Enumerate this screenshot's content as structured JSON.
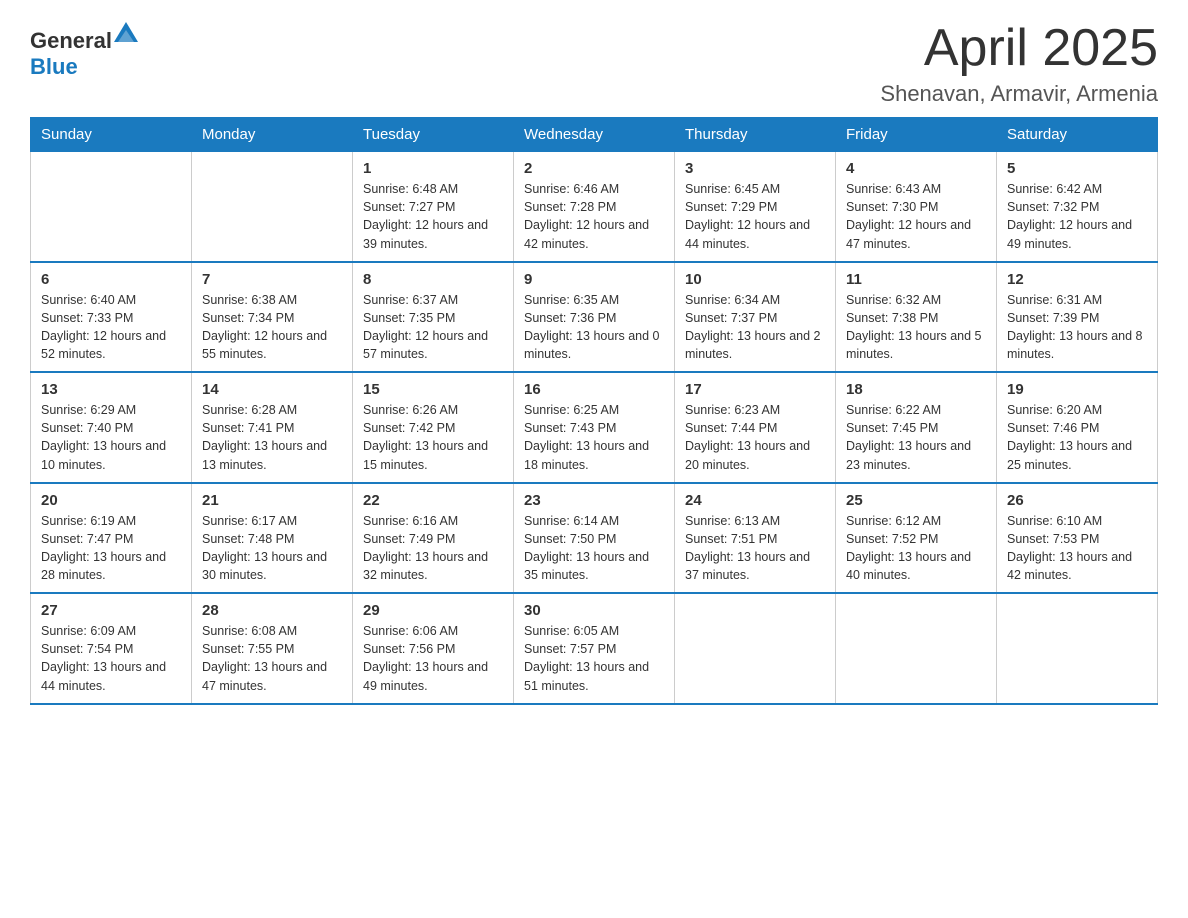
{
  "header": {
    "logo": {
      "text_general": "General",
      "text_blue": "Blue"
    },
    "title": "April 2025",
    "location": "Shenavan, Armavir, Armenia"
  },
  "days_of_week": [
    "Sunday",
    "Monday",
    "Tuesday",
    "Wednesday",
    "Thursday",
    "Friday",
    "Saturday"
  ],
  "weeks": [
    [
      {
        "day": "",
        "sunrise": "",
        "sunset": "",
        "daylight": ""
      },
      {
        "day": "",
        "sunrise": "",
        "sunset": "",
        "daylight": ""
      },
      {
        "day": "1",
        "sunrise": "Sunrise: 6:48 AM",
        "sunset": "Sunset: 7:27 PM",
        "daylight": "Daylight: 12 hours and 39 minutes."
      },
      {
        "day": "2",
        "sunrise": "Sunrise: 6:46 AM",
        "sunset": "Sunset: 7:28 PM",
        "daylight": "Daylight: 12 hours and 42 minutes."
      },
      {
        "day": "3",
        "sunrise": "Sunrise: 6:45 AM",
        "sunset": "Sunset: 7:29 PM",
        "daylight": "Daylight: 12 hours and 44 minutes."
      },
      {
        "day": "4",
        "sunrise": "Sunrise: 6:43 AM",
        "sunset": "Sunset: 7:30 PM",
        "daylight": "Daylight: 12 hours and 47 minutes."
      },
      {
        "day": "5",
        "sunrise": "Sunrise: 6:42 AM",
        "sunset": "Sunset: 7:32 PM",
        "daylight": "Daylight: 12 hours and 49 minutes."
      }
    ],
    [
      {
        "day": "6",
        "sunrise": "Sunrise: 6:40 AM",
        "sunset": "Sunset: 7:33 PM",
        "daylight": "Daylight: 12 hours and 52 minutes."
      },
      {
        "day": "7",
        "sunrise": "Sunrise: 6:38 AM",
        "sunset": "Sunset: 7:34 PM",
        "daylight": "Daylight: 12 hours and 55 minutes."
      },
      {
        "day": "8",
        "sunrise": "Sunrise: 6:37 AM",
        "sunset": "Sunset: 7:35 PM",
        "daylight": "Daylight: 12 hours and 57 minutes."
      },
      {
        "day": "9",
        "sunrise": "Sunrise: 6:35 AM",
        "sunset": "Sunset: 7:36 PM",
        "daylight": "Daylight: 13 hours and 0 minutes."
      },
      {
        "day": "10",
        "sunrise": "Sunrise: 6:34 AM",
        "sunset": "Sunset: 7:37 PM",
        "daylight": "Daylight: 13 hours and 2 minutes."
      },
      {
        "day": "11",
        "sunrise": "Sunrise: 6:32 AM",
        "sunset": "Sunset: 7:38 PM",
        "daylight": "Daylight: 13 hours and 5 minutes."
      },
      {
        "day": "12",
        "sunrise": "Sunrise: 6:31 AM",
        "sunset": "Sunset: 7:39 PM",
        "daylight": "Daylight: 13 hours and 8 minutes."
      }
    ],
    [
      {
        "day": "13",
        "sunrise": "Sunrise: 6:29 AM",
        "sunset": "Sunset: 7:40 PM",
        "daylight": "Daylight: 13 hours and 10 minutes."
      },
      {
        "day": "14",
        "sunrise": "Sunrise: 6:28 AM",
        "sunset": "Sunset: 7:41 PM",
        "daylight": "Daylight: 13 hours and 13 minutes."
      },
      {
        "day": "15",
        "sunrise": "Sunrise: 6:26 AM",
        "sunset": "Sunset: 7:42 PM",
        "daylight": "Daylight: 13 hours and 15 minutes."
      },
      {
        "day": "16",
        "sunrise": "Sunrise: 6:25 AM",
        "sunset": "Sunset: 7:43 PM",
        "daylight": "Daylight: 13 hours and 18 minutes."
      },
      {
        "day": "17",
        "sunrise": "Sunrise: 6:23 AM",
        "sunset": "Sunset: 7:44 PM",
        "daylight": "Daylight: 13 hours and 20 minutes."
      },
      {
        "day": "18",
        "sunrise": "Sunrise: 6:22 AM",
        "sunset": "Sunset: 7:45 PM",
        "daylight": "Daylight: 13 hours and 23 minutes."
      },
      {
        "day": "19",
        "sunrise": "Sunrise: 6:20 AM",
        "sunset": "Sunset: 7:46 PM",
        "daylight": "Daylight: 13 hours and 25 minutes."
      }
    ],
    [
      {
        "day": "20",
        "sunrise": "Sunrise: 6:19 AM",
        "sunset": "Sunset: 7:47 PM",
        "daylight": "Daylight: 13 hours and 28 minutes."
      },
      {
        "day": "21",
        "sunrise": "Sunrise: 6:17 AM",
        "sunset": "Sunset: 7:48 PM",
        "daylight": "Daylight: 13 hours and 30 minutes."
      },
      {
        "day": "22",
        "sunrise": "Sunrise: 6:16 AM",
        "sunset": "Sunset: 7:49 PM",
        "daylight": "Daylight: 13 hours and 32 minutes."
      },
      {
        "day": "23",
        "sunrise": "Sunrise: 6:14 AM",
        "sunset": "Sunset: 7:50 PM",
        "daylight": "Daylight: 13 hours and 35 minutes."
      },
      {
        "day": "24",
        "sunrise": "Sunrise: 6:13 AM",
        "sunset": "Sunset: 7:51 PM",
        "daylight": "Daylight: 13 hours and 37 minutes."
      },
      {
        "day": "25",
        "sunrise": "Sunrise: 6:12 AM",
        "sunset": "Sunset: 7:52 PM",
        "daylight": "Daylight: 13 hours and 40 minutes."
      },
      {
        "day": "26",
        "sunrise": "Sunrise: 6:10 AM",
        "sunset": "Sunset: 7:53 PM",
        "daylight": "Daylight: 13 hours and 42 minutes."
      }
    ],
    [
      {
        "day": "27",
        "sunrise": "Sunrise: 6:09 AM",
        "sunset": "Sunset: 7:54 PM",
        "daylight": "Daylight: 13 hours and 44 minutes."
      },
      {
        "day": "28",
        "sunrise": "Sunrise: 6:08 AM",
        "sunset": "Sunset: 7:55 PM",
        "daylight": "Daylight: 13 hours and 47 minutes."
      },
      {
        "day": "29",
        "sunrise": "Sunrise: 6:06 AM",
        "sunset": "Sunset: 7:56 PM",
        "daylight": "Daylight: 13 hours and 49 minutes."
      },
      {
        "day": "30",
        "sunrise": "Sunrise: 6:05 AM",
        "sunset": "Sunset: 7:57 PM",
        "daylight": "Daylight: 13 hours and 51 minutes."
      },
      {
        "day": "",
        "sunrise": "",
        "sunset": "",
        "daylight": ""
      },
      {
        "day": "",
        "sunrise": "",
        "sunset": "",
        "daylight": ""
      },
      {
        "day": "",
        "sunrise": "",
        "sunset": "",
        "daylight": ""
      }
    ]
  ]
}
